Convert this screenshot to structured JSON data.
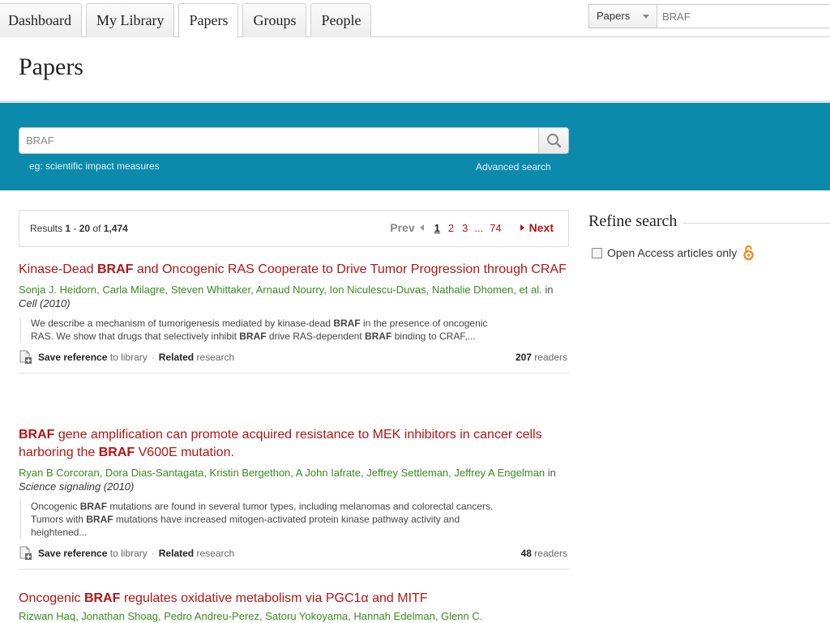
{
  "nav": {
    "tabs": [
      {
        "label": "Dashboard"
      },
      {
        "label": "My Library"
      },
      {
        "label": "Papers"
      },
      {
        "label": "Groups"
      },
      {
        "label": "People"
      }
    ],
    "active_tab": "Papers"
  },
  "top_search": {
    "scope": "Papers",
    "query": "BRAF"
  },
  "page": {
    "title": "Papers"
  },
  "search": {
    "query": "BRAF",
    "hint": "eg: scientific impact measures",
    "advanced": "Advanced search"
  },
  "results": {
    "prefix": "Results ",
    "from": "1",
    "dash": " - ",
    "to": "20",
    "of": " of ",
    "total": "1,474"
  },
  "pager": {
    "prev": "Prev",
    "pages": [
      "1",
      "2",
      "3"
    ],
    "ellipsis": "...",
    "last": "74",
    "next": "Next"
  },
  "papers": [
    {
      "title_parts": [
        "Kinase-Dead ",
        "BRAF",
        " and Oncogenic RAS Cooperate to Drive Tumor Progression through CRAF"
      ],
      "authors": "Sonja J. Heidorn, Carla Milagre, Steven Whittaker, Arnaud Nourry, Ion Niculescu-Duvas, Nathalie Dhomen, et al.",
      "in": " in ",
      "journal": "Cell (2010)",
      "abstract_parts": [
        "We describe a mechanism of tumorigenesis mediated by kinase-dead ",
        "BRAF",
        " in the presence of oncogenic RAS. We show that drugs that selectively inhibit ",
        "BRAF",
        " drive RAS-dependent ",
        "BRAF",
        " binding to CRAF,..."
      ],
      "save_bold": "Save reference",
      "save_rest": " to library",
      "sep": "·",
      "related_bold": "Related",
      "related_rest": " research",
      "readers_count": "207",
      "readers_label": " readers"
    },
    {
      "title_parts": [
        "BRAF",
        " gene amplification can promote acquired resistance to MEK inhibitors in cancer cells harboring the ",
        "BRAF",
        " V600E mutation."
      ],
      "authors": "Ryan B Corcoran, Dora Dias-Santagata, Kristin Bergethon, A John Iafrate, Jeffrey Settleman, Jeffrey A Engelman",
      "in": " in ",
      "journal": "Science signaling (2010)",
      "abstract_parts": [
        "Oncogenic ",
        "BRAF",
        " mutations are found in several tumor types, including melanomas and colorectal cancers. Tumors with ",
        "BRAF",
        " mutations have increased mitogen-activated protein kinase pathway activity and heightened..."
      ],
      "save_bold": "Save reference",
      "save_rest": " to library",
      "sep": "·",
      "related_bold": "Related",
      "related_rest": " research",
      "readers_count": "48",
      "readers_label": " readers"
    },
    {
      "title_parts": [
        "Oncogenic ",
        "BRAF",
        " regulates oxidative metabolism via PGC1α and MITF"
      ],
      "authors": "Rizwan Haq, Jonathan Shoag, Pedro Andreu-Perez, Satoru Yokoyama, Hannah Edelman, Glenn C."
    }
  ],
  "refine": {
    "title": "Refine search",
    "open_access_label": "Open Access articles only"
  },
  "colors": {
    "brand_band": "#0b8aab",
    "link_red": "#b41515",
    "author_green": "#3a8a1e",
    "oa_orange": "#f08a1c"
  },
  "icons": {
    "search": "search-icon",
    "save": "add-document-icon",
    "open_access": "open-access-lock-icon",
    "dropdown": "chevron-down-icon"
  }
}
